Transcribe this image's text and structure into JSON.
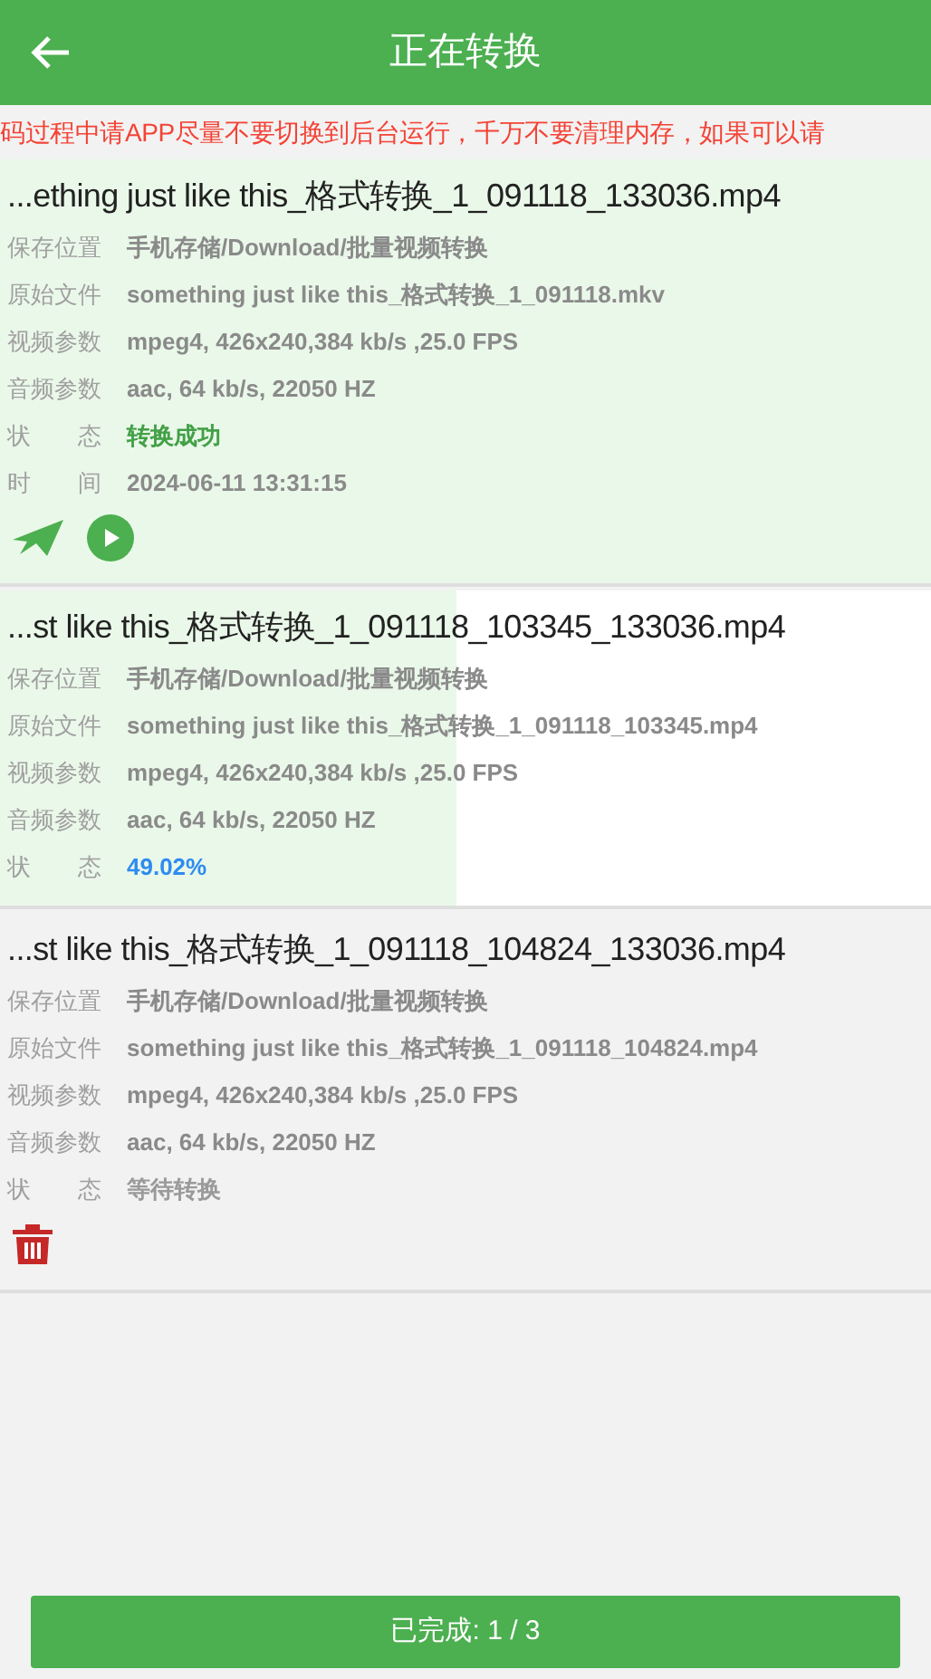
{
  "header": {
    "title": "正在转换"
  },
  "notice": "码过程中请APP尽量不要切换到后台运行，千万不要清理内存，如果可以请",
  "tasks": [
    {
      "title": "...ething just like this_格式转换_1_091118_133036.mp4",
      "kind": "done",
      "fields": [
        {
          "label": "保存位置",
          "value": "手机存储/Download/批量视频转换"
        },
        {
          "label": "原始文件",
          "value": "something just like this_格式转换_1_091118.mkv"
        },
        {
          "label": "视频参数",
          "value": "mpeg4, 426x240,384 kb/s ,25.0 FPS"
        },
        {
          "label": "音频参数",
          "value": "aac, 64 kb/s, 22050 HZ"
        },
        {
          "label": "状　　态",
          "value": "转换成功",
          "kind": "status"
        },
        {
          "label": "时　　间",
          "value": "2024-06-11 13:31:15"
        }
      ],
      "actions": [
        {
          "kind": "send"
        },
        {
          "kind": "play"
        }
      ]
    },
    {
      "title": "...st like this_格式转换_1_091118_103345_133036.mp4",
      "kind": "progress",
      "level": 0.4902,
      "fields": [
        {
          "label": "保存位置",
          "value": "手机存储/Download/批量视频转换"
        },
        {
          "label": "原始文件",
          "value": "something just like this_格式转换_1_091118_103345.mp4"
        },
        {
          "label": "视频参数",
          "value": "mpeg4, 426x240,384 kb/s ,25.0 FPS"
        },
        {
          "label": "音频参数",
          "value": "aac, 64 kb/s, 22050 HZ"
        },
        {
          "label": "状　　态",
          "value": "49.02%",
          "kind": "status"
        }
      ]
    },
    {
      "title": "...st like this_格式转换_1_091118_104824_133036.mp4",
      "kind": "waiting",
      "fields": [
        {
          "label": "保存位置",
          "value": "手机存储/Download/批量视频转换"
        },
        {
          "label": "原始文件",
          "value": "something just like this_格式转换_1_091118_104824.mp4"
        },
        {
          "label": "视频参数",
          "value": "mpeg4, 426x240,384 kb/s ,25.0 FPS"
        },
        {
          "label": "音频参数",
          "value": "aac, 64 kb/s, 22050 HZ"
        },
        {
          "label": "状　　态",
          "value": "等待转换",
          "kind": "status"
        }
      ],
      "actions": [
        {
          "kind": "delete"
        }
      ]
    }
  ],
  "footer_button": "已完成: 1 / 3"
}
